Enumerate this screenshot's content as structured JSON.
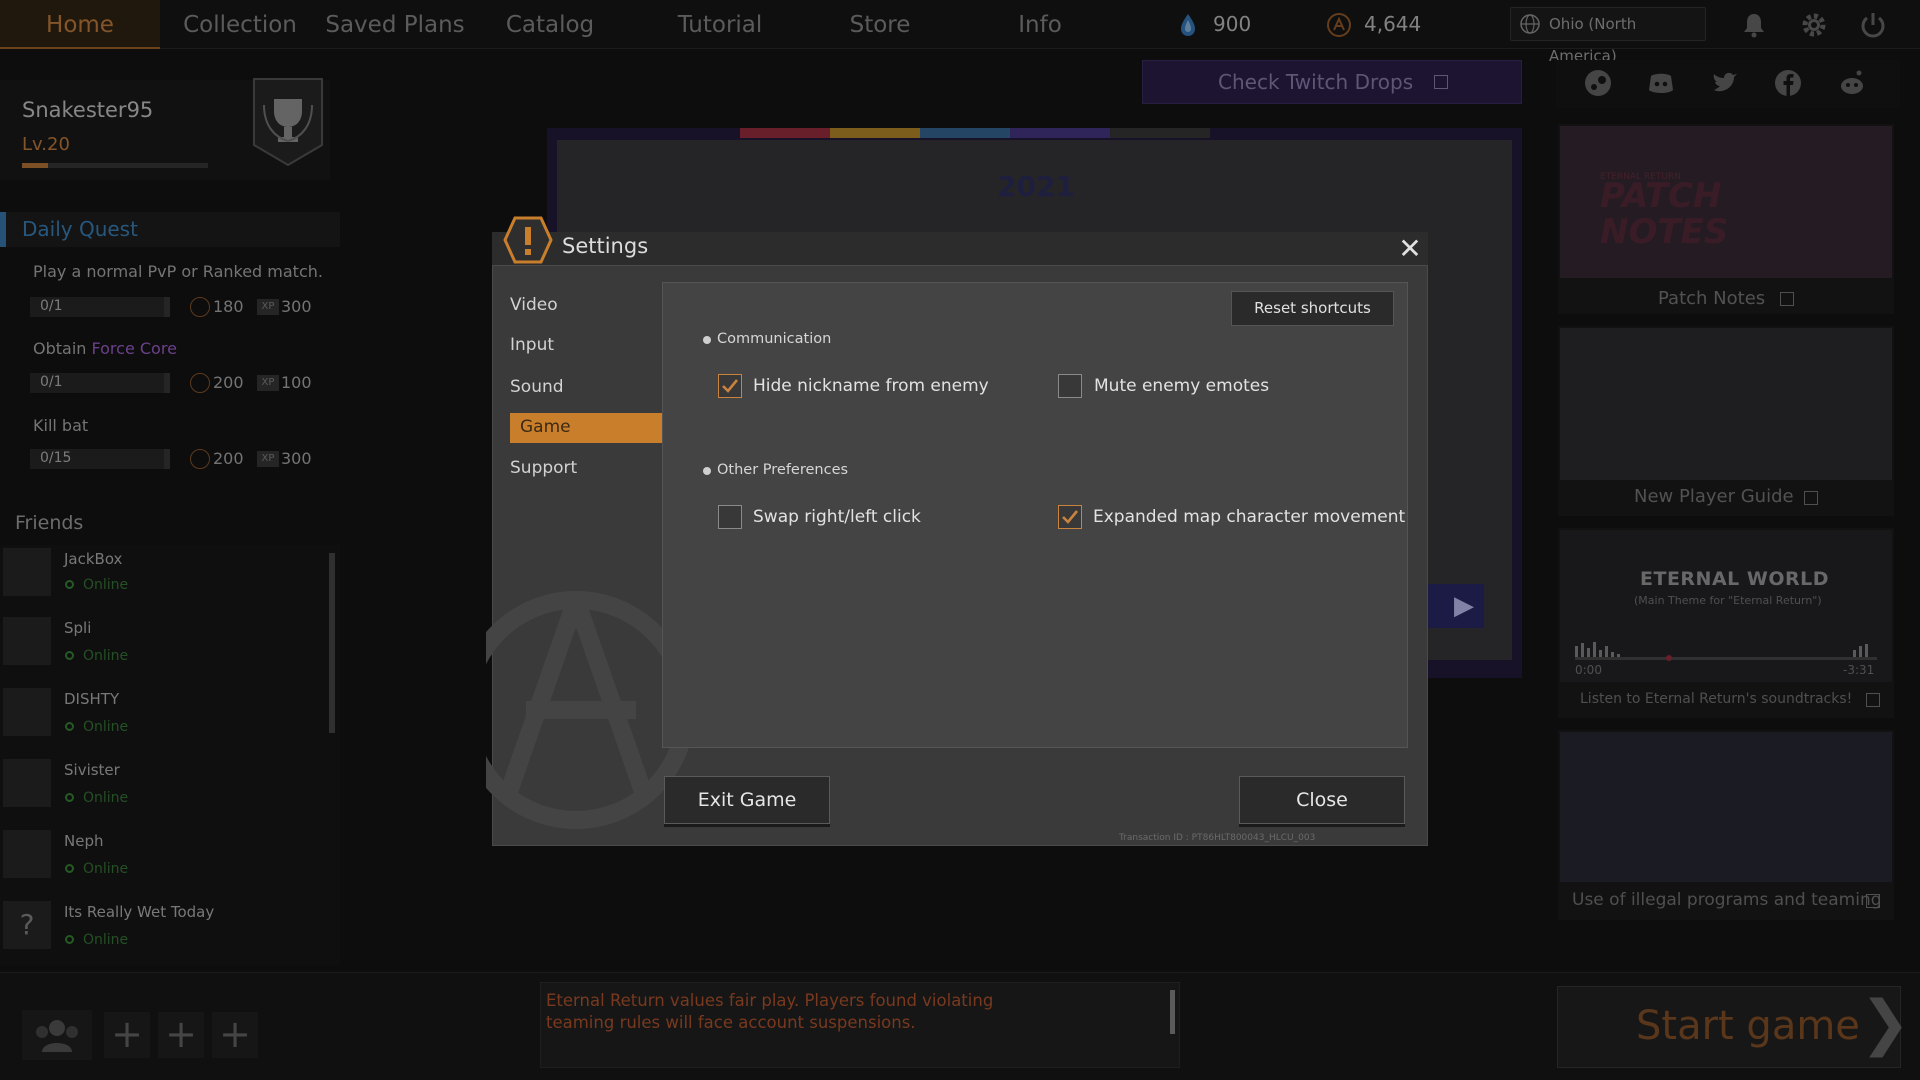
{
  "nav": {
    "items": [
      "Home",
      "Collection",
      "Saved Plans",
      "Catalog",
      "Tutorial",
      "Store",
      "Info"
    ],
    "active": "Home"
  },
  "currency": {
    "gems": "900",
    "coins": "4,644"
  },
  "region": "Ohio (North America)",
  "profile": {
    "username": "Snakester95",
    "level": "Lv.20",
    "xp_fraction": 0.14
  },
  "daily_quest": {
    "title": "Daily Quest",
    "quests": [
      {
        "text": "Play a normal PvP or Ranked match.",
        "progress": "0/1",
        "coin": "180",
        "xp": "300"
      },
      {
        "text_prefix": "Obtain ",
        "text_highlight": "Force Core",
        "progress": "0/1",
        "coin": "200",
        "xp": "100"
      },
      {
        "text": "Kill bat",
        "progress": "0/15",
        "coin": "200",
        "xp": "300"
      }
    ]
  },
  "friends": {
    "title": "Friends",
    "list": [
      {
        "name": "JackBox",
        "status": "Online"
      },
      {
        "name": "Spli",
        "status": "Online"
      },
      {
        "name": "DISHTY",
        "status": "Online"
      },
      {
        "name": "Sivister",
        "status": "Online"
      },
      {
        "name": "Neph",
        "status": "Online"
      },
      {
        "name": "Its Really Wet Today",
        "status": "Online"
      }
    ]
  },
  "notice": "Eternal Return values fair play. Players found violating teaming rules will face account suspensions.",
  "start_game": "Start game",
  "twitch": "Check Twitch Drops",
  "banner": {
    "year": "2021"
  },
  "right_cards": {
    "patch_notes_art": "PATCH NOTES",
    "patch_notes_small": "ETERNAL RETURN",
    "patch_notes": "Patch Notes",
    "new_player_guide": "New Player Guide",
    "eternal_world": "ETERNAL WORLD",
    "eternal_world_sub": "(Main Theme for \"Eternal Return\")",
    "time_start": "0:00",
    "time_end": "-3:31",
    "soundtrack": "Listen to Eternal Return's soundtracks!",
    "illegal": "Use of illegal programs and teaming"
  },
  "dialog": {
    "title": "Settings",
    "tabs": [
      "Video",
      "Input",
      "Sound",
      "Game",
      "Support"
    ],
    "active_tab": "Game",
    "reset_shortcuts": "Reset shortcuts",
    "sections": [
      {
        "title": "Communication",
        "options": [
          {
            "label": "Hide nickname from enemy",
            "checked": true
          },
          {
            "label": "Mute enemy emotes",
            "checked": false
          }
        ]
      },
      {
        "title": "Other Preferences",
        "options": [
          {
            "label": "Swap right/left click",
            "checked": false
          },
          {
            "label": "Expanded map character movement",
            "checked": true
          }
        ]
      }
    ],
    "exit_game": "Exit Game",
    "close": "Close",
    "transaction": "Transaction ID : PT86HLT800043_HLCU_003"
  },
  "colors": {
    "accent_orange": "#c9833f",
    "quest_blue": "#3d86c0",
    "force_purple": "#a463d6",
    "twitch_purple": "#2b1f4a"
  },
  "icons": [
    "gem-icon",
    "coin-icon",
    "globe-icon",
    "bell-icon",
    "gear-icon",
    "power-icon",
    "steam-icon",
    "discord-icon",
    "twitter-icon",
    "facebook-icon",
    "reddit-icon",
    "trophy-icon",
    "warning-icon",
    "close-icon",
    "external-link-icon",
    "party-icon",
    "plus-icon",
    "play-icon"
  ]
}
